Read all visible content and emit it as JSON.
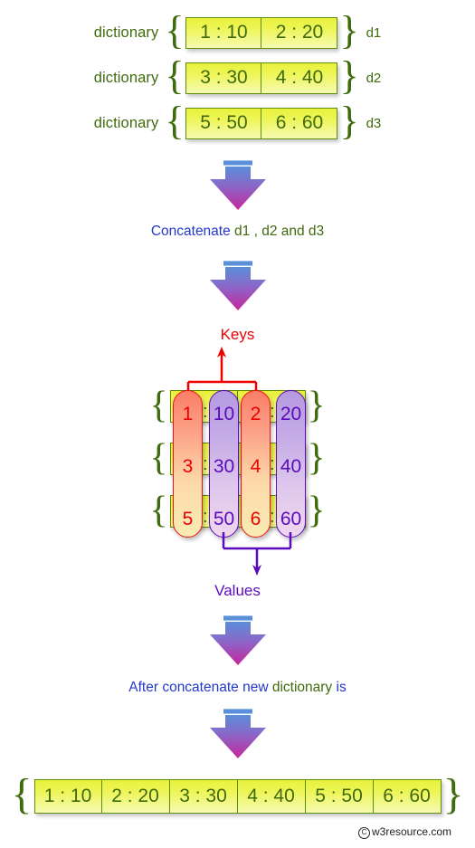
{
  "diagram": {
    "title": "Concatenate dictionaries",
    "colors": {
      "green_text": "#3f6b0d",
      "blue_text": "#2438c8",
      "key_red": "#ee0000",
      "value_purple": "#5b0bbd",
      "cell_yellow": "#e8f23c",
      "arrow_top": "#5b8fd9",
      "arrow_bottom": "#c4279b"
    }
  },
  "inputs": [
    {
      "label": "dictionary",
      "open_brace": "{",
      "close_brace": "}",
      "name": "d1",
      "cells": [
        "1 : 10",
        "2 : 20"
      ]
    },
    {
      "label": "dictionary",
      "open_brace": "{",
      "close_brace": "}",
      "name": "d2",
      "cells": [
        "3 : 30",
        "4 : 40"
      ]
    },
    {
      "label": "dictionary",
      "open_brace": "{",
      "close_brace": "}",
      "name": "d3",
      "cells": [
        "5 : 50",
        "6 : 60"
      ]
    }
  ],
  "captions": {
    "concatenate": {
      "blue": "Concatenate",
      "green": "d1 , d2 and d3"
    },
    "after": {
      "blue_before": "After concatenate new",
      "green": "dictionary",
      "blue_after": "is"
    }
  },
  "labels": {
    "keys": "Keys",
    "values": "Values"
  },
  "table": {
    "open_brace": "{",
    "close_brace": "}",
    "colon": ":",
    "rows": [
      {
        "key1": "1",
        "val1": "10",
        "key2": "2",
        "val2": "20"
      },
      {
        "key1": "3",
        "val1": "30",
        "key2": "4",
        "val2": "40"
      },
      {
        "key1": "5",
        "val1": "50",
        "key2": "6",
        "val2": "60"
      }
    ]
  },
  "result": {
    "open_brace": "{",
    "close_brace": "}",
    "cells": [
      "1 : 10",
      "2 : 20",
      "3 : 30",
      "4 : 40",
      "5 : 50",
      "6 : 60"
    ]
  },
  "watermark": {
    "symbol": "C",
    "text": "w3resource.com"
  }
}
